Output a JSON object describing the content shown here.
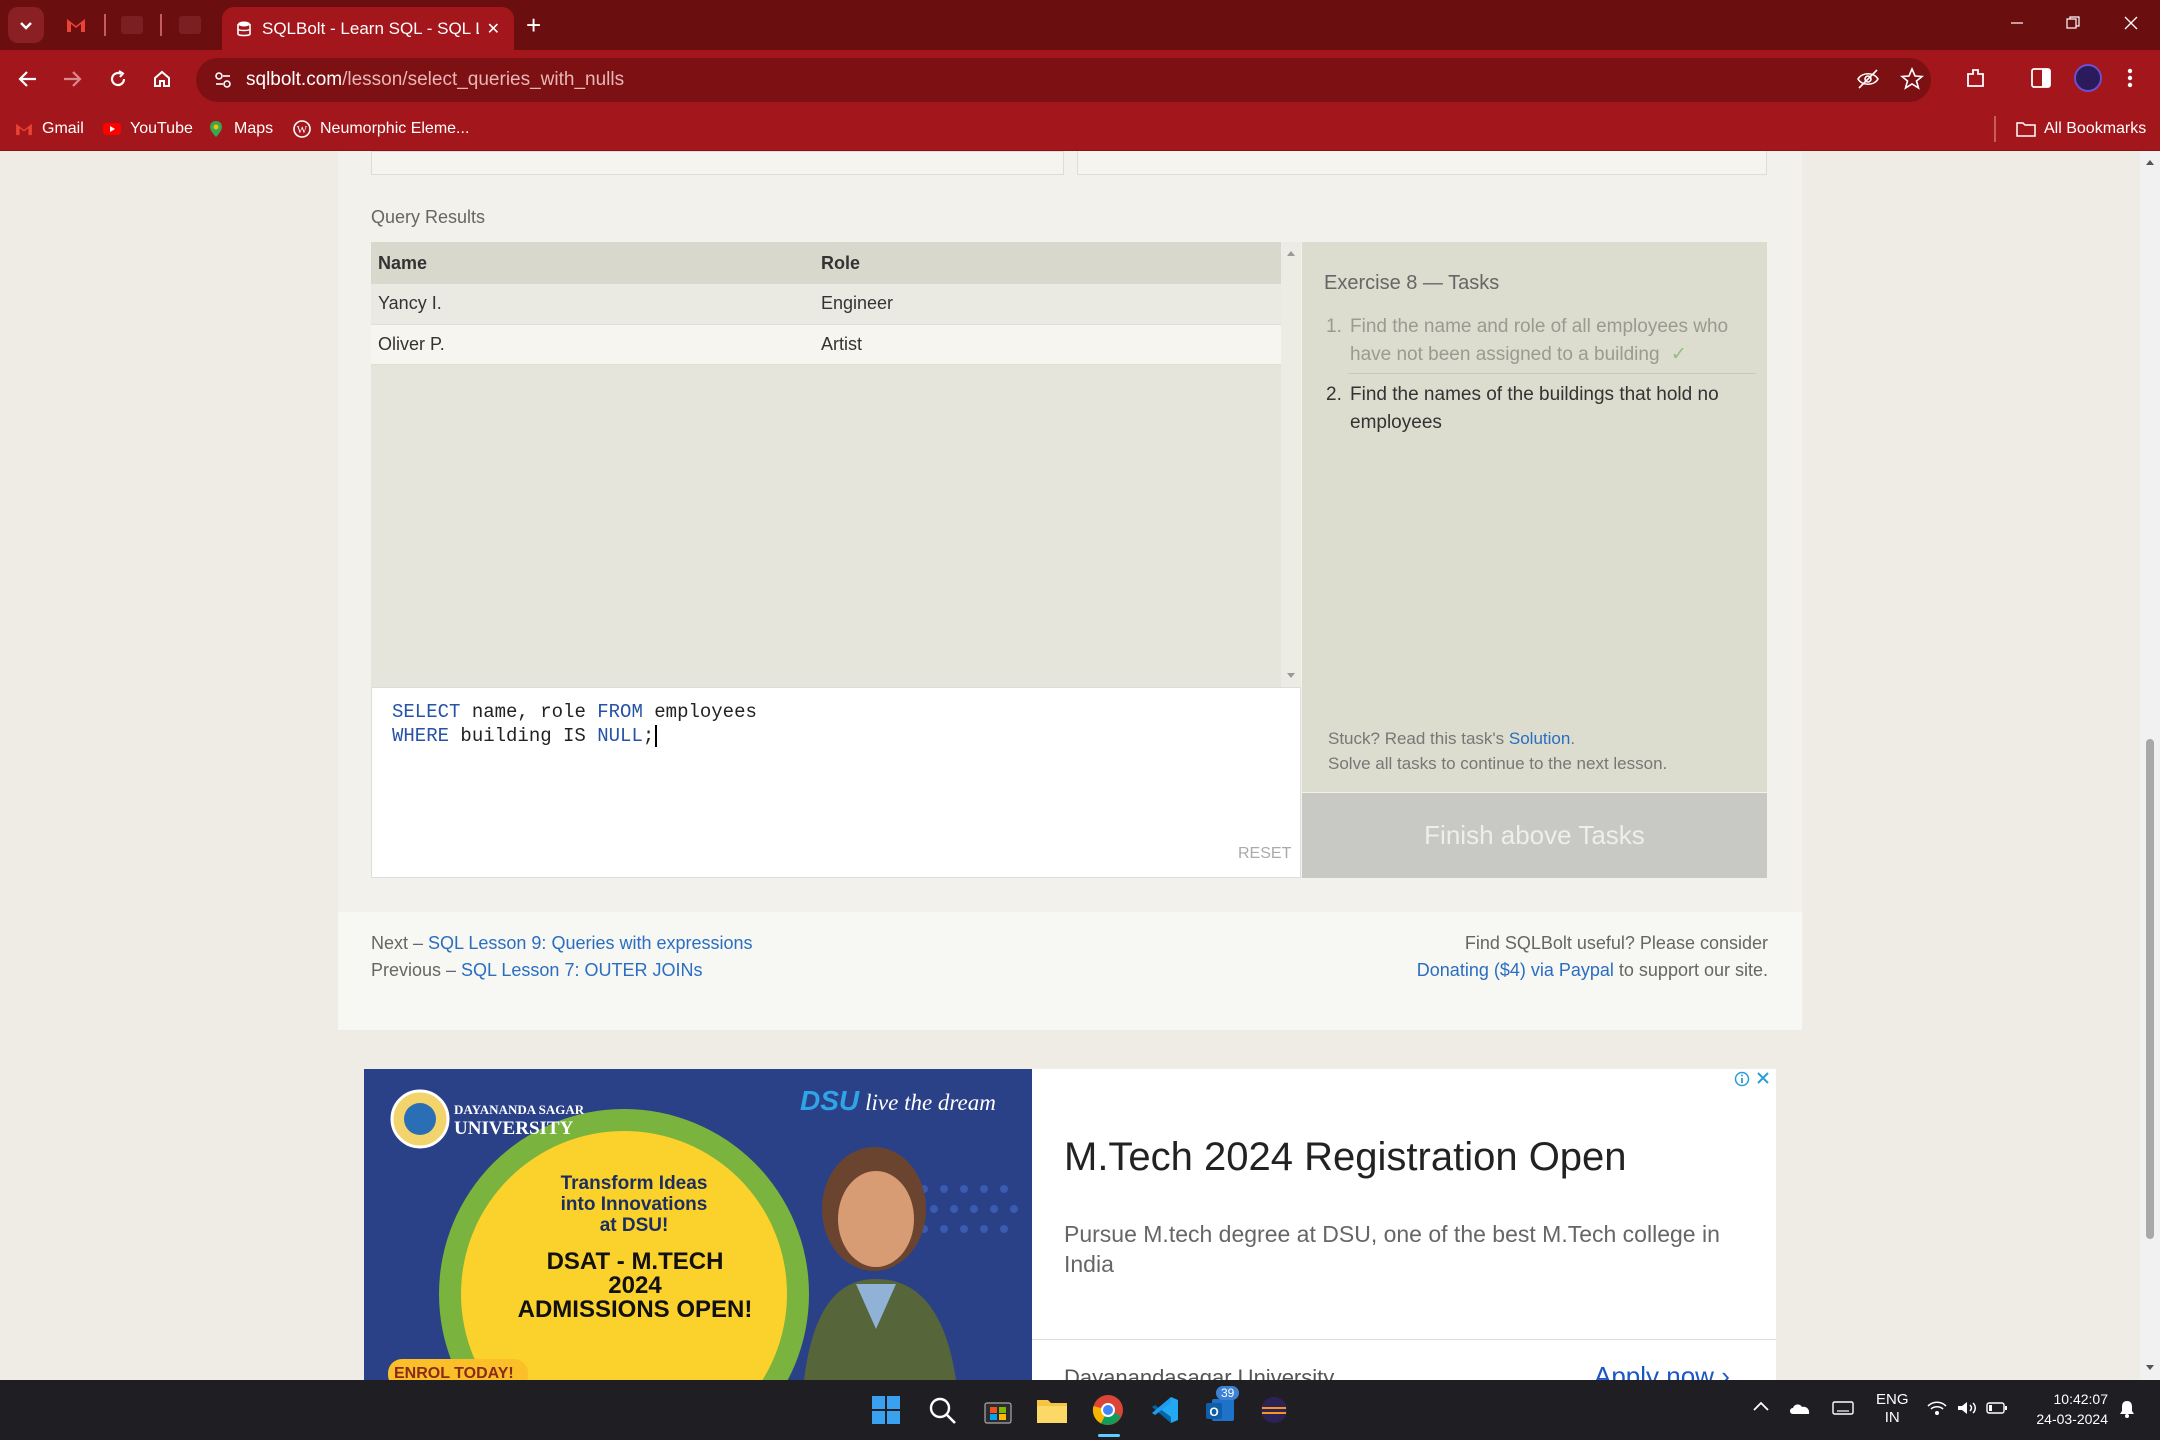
{
  "browser": {
    "active_tab_title": "SQLBolt - Learn SQL - SQL Less",
    "url_host": "sqlbolt.com",
    "url_path": "/lesson/select_queries_with_nulls",
    "new_tab_symbol": "+",
    "tab_close_symbol": "✕",
    "bookmarks": [
      {
        "label": "Gmail"
      },
      {
        "label": "YouTube"
      },
      {
        "label": "Maps"
      },
      {
        "label": "Neumorphic Eleme..."
      }
    ],
    "all_bookmarks_label": "All Bookmarks"
  },
  "lesson": {
    "query_results_label": "Query Results",
    "results_table": {
      "columns": [
        "Name",
        "Role"
      ],
      "rows": [
        [
          "Yancy I.",
          "Engineer"
        ],
        [
          "Oliver P.",
          "Artist"
        ]
      ]
    },
    "editor": {
      "line1": {
        "kw1": "SELECT",
        "t1": " name, role ",
        "kw2": "FROM",
        "t2": " employees"
      },
      "line2": {
        "kw1": "WHERE",
        "t1": " building IS ",
        "kw2": "NULL",
        "t2": ";"
      }
    },
    "reset_label": "RESET",
    "tasks": {
      "title": "Exercise 8 — Tasks",
      "items": [
        {
          "num": "1.",
          "text": "Find the name and role of all employees who have not been assigned to a building",
          "check": "✓"
        },
        {
          "num": "2.",
          "text": "Find the names of the buildings that hold no employees"
        }
      ],
      "stuck_prefix": "Stuck? Read this task's ",
      "solution_link": "Solution",
      "stuck_suffix": ".",
      "solve_all": "Solve all tasks to continue to the next lesson.",
      "finish_button": "Finish above Tasks"
    },
    "footer": {
      "next_prefix": "Next – ",
      "next_link": "SQL Lesson 9: Queries with expressions",
      "prev_prefix": "Previous – ",
      "prev_link": "SQL Lesson 7: OUTER JOINs",
      "donate_line1": "Find SQLBolt useful? Please consider",
      "donate_link": "Donating ($4) via Paypal",
      "donate_suffix": " to support our site."
    }
  },
  "ad": {
    "university_line1": "DAYANANDA SAGAR",
    "university_line2": "UNIVERSITY",
    "dsu_logo": "DSU",
    "tagline": "live the dream",
    "transform_line1": "Transform Ideas",
    "transform_line2": "into Innovations",
    "transform_line3": "at DSU!",
    "dsat_line1": "DSAT - M.TECH",
    "dsat_line2": "2024",
    "dsat_line3": "ADMISSIONS OPEN!",
    "enrol": "ENROL TODAY!",
    "title": "M.Tech 2024 Registration Open",
    "description": "Pursue M.tech degree at DSU, one of the best M.Tech college in India",
    "advertiser": "Dayanandasagar University",
    "cta": "Apply now"
  },
  "taskbar": {
    "language_line1": "ENG",
    "language_line2": "IN",
    "time": "10:42:07",
    "date": "24-03-2024",
    "outlook_badge": "39"
  },
  "colors": {
    "chrome_dark": "#6b0e10",
    "chrome": "#a3161b",
    "link": "#2a6ec0",
    "keyword": "#2653a6"
  }
}
